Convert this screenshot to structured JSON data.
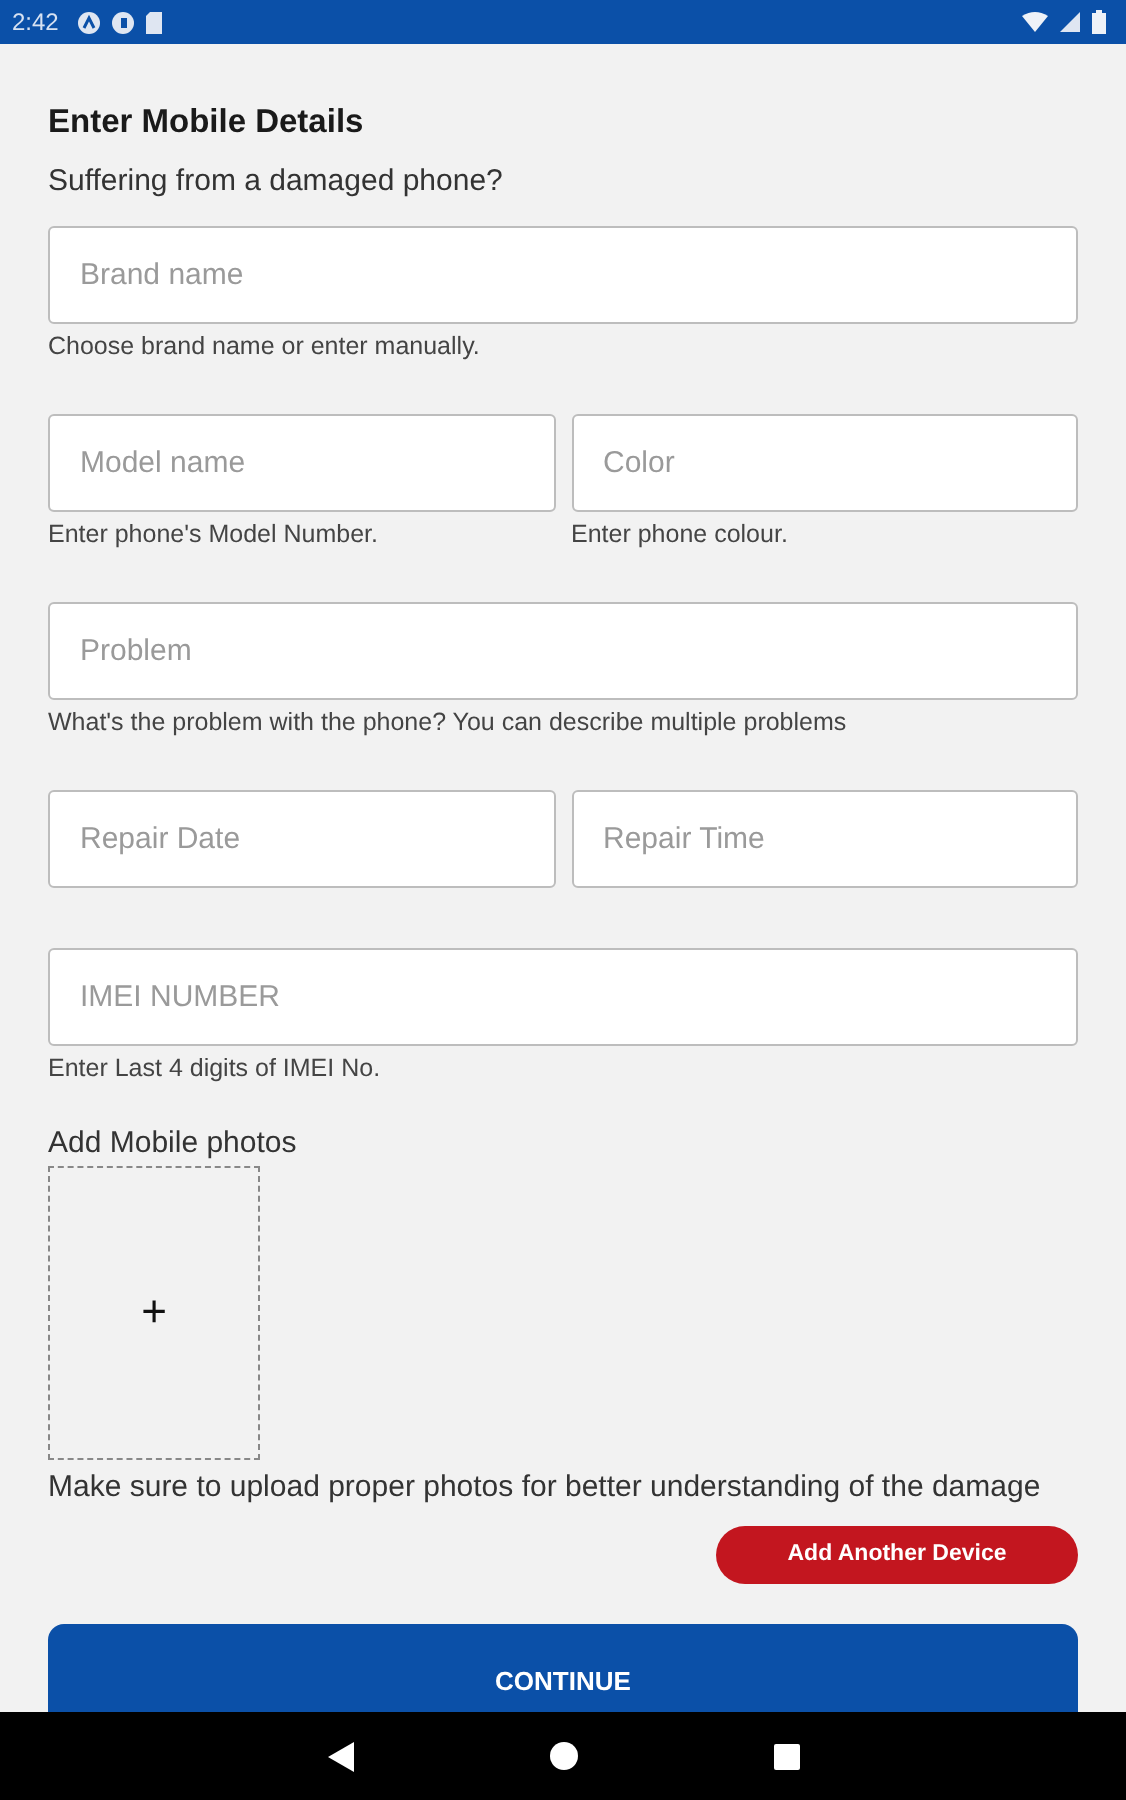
{
  "status_bar": {
    "time": "2:42"
  },
  "form": {
    "title": "Enter Mobile Details",
    "subtitle": "Suffering from a damaged phone?",
    "rows": [
      {
        "fields": [
          {
            "placeholder": "Brand name",
            "helper": "Choose brand name or enter manually."
          }
        ]
      },
      {
        "fields": [
          {
            "placeholder": "Model name",
            "helper": "Enter phone's Model Number."
          },
          {
            "placeholder": "Color",
            "helper": "Enter phone colour."
          }
        ]
      },
      {
        "fields": [
          {
            "placeholder": "Problem",
            "helper": "What's the problem with the phone? You can describe multiple problems"
          }
        ]
      },
      {
        "fields": [
          {
            "placeholder": "Repair Date"
          },
          {
            "placeholder": "Repair Time"
          }
        ]
      },
      {
        "fields": [
          {
            "placeholder": "IMEI NUMBER",
            "helper": "Enter Last 4 digits of IMEI No."
          }
        ]
      }
    ],
    "photos": {
      "label": "Add Mobile photos",
      "add_symbol": "+",
      "note": "Make sure to upload proper photos for better understanding of the damage"
    },
    "add_device_button": "Add Another Device",
    "continue_button": "CONTINUE"
  }
}
